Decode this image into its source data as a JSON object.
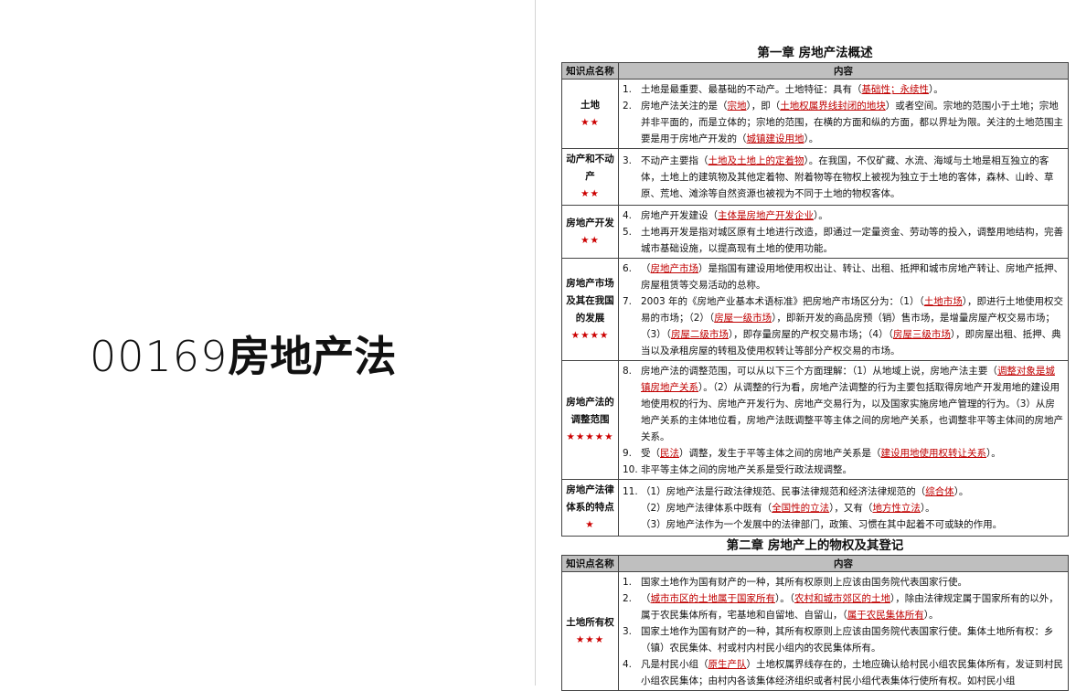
{
  "cover": {
    "code": "00169",
    "name": "房地产法"
  },
  "colors": {
    "highlight": "#c00000",
    "stars": "#cc0000",
    "header_bg": "#bfbfbf"
  },
  "chapters": [
    {
      "title": "第一章  房地产法概述",
      "headers": [
        "知识点名称",
        "内容"
      ],
      "rows": [
        {
          "name": "土地",
          "stars": "★★",
          "items": [
            {
              "num": "1.",
              "segments": [
                {
                  "t": "土地是最重要、最基础的不动产。土地特征：具有（"
                },
                {
                  "t": "基础性；永续性",
                  "hl": true
                },
                {
                  "t": "）。"
                }
              ]
            },
            {
              "num": "2.",
              "segments": [
                {
                  "t": "房地产法关注的是（"
                },
                {
                  "t": "宗地",
                  "hl": true
                },
                {
                  "t": "），即（"
                },
                {
                  "t": "土地权属界线封闭的地块",
                  "hl": true
                },
                {
                  "t": "）或者空间。宗地的范围小于土地；宗地并非平面的，而是立体的；宗地的范围，在横的方面和纵的方面，都以界址为限。关注的土地范围主要是用于房地产开发的（"
                },
                {
                  "t": "城镇建设用地",
                  "hl": true
                },
                {
                  "t": "）。"
                }
              ]
            }
          ]
        },
        {
          "name": "动产和不动产",
          "stars": "★★",
          "items": [
            {
              "num": "3.",
              "segments": [
                {
                  "t": "不动产主要指（"
                },
                {
                  "t": "土地及土地上的定着物",
                  "hl": true
                },
                {
                  "t": "）。在我国，不仅矿藏、水流、海域与土地是相互独立的客体，土地上的建筑物及其他定着物、附着物等在物权上被视为独立于土地的客体，森林、山岭、草原、荒地、滩涂等自然资源也被视为不同于土地的物权客体。"
                }
              ]
            }
          ]
        },
        {
          "name": "房地产开发",
          "stars": "★★",
          "items": [
            {
              "num": "4.",
              "segments": [
                {
                  "t": "房地产开发建设（"
                },
                {
                  "t": "主体是房地产开发企业",
                  "hl": true
                },
                {
                  "t": "）。"
                }
              ]
            },
            {
              "num": "5.",
              "segments": [
                {
                  "t": "土地再开发是指对城区原有土地进行改造，即通过一定量资金、劳动等的投入，调整用地结构，完善城市基础设施，以提高现有土地的使用功能。"
                }
              ]
            }
          ]
        },
        {
          "name": "房地产市场及其在我国的发展",
          "stars": "★★★★",
          "items": [
            {
              "num": "6.",
              "segments": [
                {
                  "t": "（"
                },
                {
                  "t": "房地产市场",
                  "hl": true
                },
                {
                  "t": "）是指国有建设用地使用权出让、转让、出租、抵押和城市房地产转让、房地产抵押、房屋租赁等交易活动的总称。"
                }
              ]
            },
            {
              "num": "7.",
              "segments": [
                {
                  "t": "2003 年的《房地产业基本术语标准》把房地产市场区分为：（1）（"
                },
                {
                  "t": "土地市场",
                  "hl": true
                },
                {
                  "t": "），即进行土地使用权交易的市场；（2）（"
                },
                {
                  "t": "房屋一级市场",
                  "hl": true
                },
                {
                  "t": "），即新开发的商品房预（销）售市场，是增量房屋产权交易市场；（3）（"
                },
                {
                  "t": "房屋二级市场",
                  "hl": true
                },
                {
                  "t": "），即存量房屋的产权交易市场；（4）（"
                },
                {
                  "t": "房屋三级市场",
                  "hl": true
                },
                {
                  "t": "），即房屋出租、抵押、典当以及承租房屋的转租及使用权转让等部分产权交易的市场。"
                }
              ]
            }
          ]
        },
        {
          "name": "房地产法的调整范围",
          "stars": "★★★★★",
          "items": [
            {
              "num": "8.",
              "segments": [
                {
                  "t": "房地产法的调整范围，可以从以下三个方面理解：（1）从地域上说，房地产法主要（"
                },
                {
                  "t": "调整对象是城镇房地产关系",
                  "hl": true
                },
                {
                  "t": "）。（2）从调整的行为看，房地产法调整的行为主要包括取得房地产开发用地的建设用地使用权的行为、房地产开发行为、房地产交易行为，以及国家实施房地产管理的行为。（3）从房地产关系的主体地位看，房地产法既调整平等主体之间的房地产关系，也调整非平等主体间的房地产关系。"
                }
              ]
            },
            {
              "num": "9.",
              "segments": [
                {
                  "t": "受（"
                },
                {
                  "t": "民法",
                  "hl": true
                },
                {
                  "t": "）调整，发生于平等主体之间的房地产关系是（"
                },
                {
                  "t": "建设用地使用权转让关系",
                  "hl": true
                },
                {
                  "t": "）。"
                }
              ]
            },
            {
              "num": "10.",
              "segments": [
                {
                  "t": "非平等主体之间的房地产关系是受行政法规调整。"
                }
              ]
            }
          ]
        },
        {
          "name": "房地产法律体系的特点",
          "stars": "★",
          "items": [
            {
              "num": "11.",
              "segments": [
                {
                  "t": "（1）房地产法是行政法律规范、民事法律规范和经济法律规范的（"
                },
                {
                  "t": "综合体",
                  "hl": true
                },
                {
                  "t": "）。"
                }
              ]
            }
          ],
          "subs": [
            {
              "segments": [
                {
                  "t": "（2）房地产法律体系中既有（"
                },
                {
                  "t": "全国性的立法",
                  "hl": true
                },
                {
                  "t": "），又有（"
                },
                {
                  "t": "地方性立法",
                  "hl": true
                },
                {
                  "t": "）。"
                }
              ]
            },
            {
              "segments": [
                {
                  "t": "（3）房地产法作为一个发展中的法律部门，政策、习惯在其中起着不可或缺的作用。"
                }
              ]
            }
          ]
        }
      ]
    },
    {
      "title": "第二章  房地产上的物权及其登记",
      "headers": [
        "知识点名称",
        "内容"
      ],
      "rows": [
        {
          "name": "土地所有权",
          "stars": "★★★",
          "items": [
            {
              "num": "1.",
              "segments": [
                {
                  "t": "国家土地作为国有财产的一种，其所有权原则上应该由国务院代表国家行使。"
                }
              ]
            },
            {
              "num": "2.",
              "segments": [
                {
                  "t": "（"
                },
                {
                  "t": "城市市区的土地属于国家所有",
                  "hl": true
                },
                {
                  "t": "）。（"
                },
                {
                  "t": "农村和城市郊区的土地",
                  "hl": true
                },
                {
                  "t": "），除由法律规定属于国家所有的以外，属于农民集体所有，宅基地和自留地、自留山，（"
                },
                {
                  "t": "属于农民集体所有",
                  "hl": true
                },
                {
                  "t": "）。"
                }
              ]
            },
            {
              "num": "3.",
              "segments": [
                {
                  "t": "国家土地作为国有财产的一种，其所有权原则上应该由国务院代表国家行使。集体土地所有权：乡（镇）农民集体、村或村内村民小组内的农民集体所有。"
                }
              ]
            },
            {
              "num": "4.",
              "segments": [
                {
                  "t": "凡是村民小组（"
                },
                {
                  "t": "原生产队",
                  "hl": true
                },
                {
                  "t": "）土地权属界线存在的，土地应确认给村民小组农民集体所有，发证到村民小组农民集体；由村内各该集体经济组织或者村民小组代表集体行使所有权。如村民小组"
                }
              ]
            }
          ]
        }
      ]
    }
  ]
}
